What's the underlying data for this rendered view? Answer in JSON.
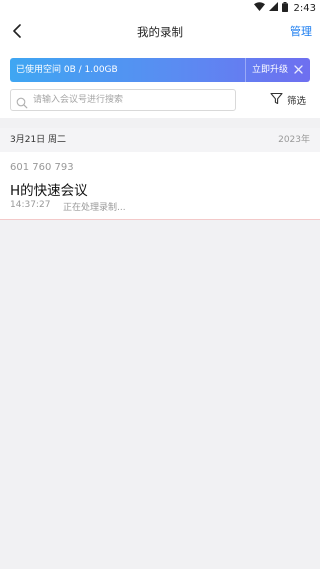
{
  "status_bar": {
    "time": "2:43",
    "icons": [
      "wifi-icon",
      "cellular-icon",
      "battery-icon"
    ]
  },
  "nav": {
    "back_icon": "chevron-left-icon",
    "title": "我的录制",
    "action_label": "管理",
    "action_color": "#1a7cf0"
  },
  "storage_banner": {
    "used_text": "已使用空间 0B / 1.00GB",
    "upgrade_label": "立即升级",
    "close_icon": "close-icon",
    "gradient": [
      "#3fa6f2",
      "#5a8cf2",
      "#6e6ff0"
    ]
  },
  "search": {
    "placeholder": "请输入会议号进行搜索",
    "value": "",
    "icon": "search-icon"
  },
  "filter": {
    "label": "筛选",
    "icon": "filter-icon"
  },
  "date_group": {
    "date": "3月21日 周二",
    "year": "2023年"
  },
  "meetings": [
    {
      "meeting_id": "601 760 793",
      "title": "H的快速会议",
      "time": "14:37:27",
      "status": "正在处理录制..."
    }
  ]
}
